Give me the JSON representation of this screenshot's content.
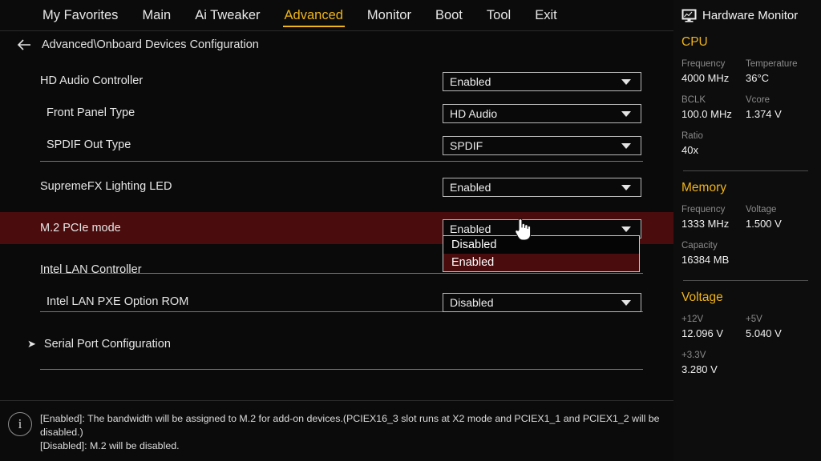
{
  "nav": {
    "items": [
      {
        "label": "My Favorites",
        "active": false
      },
      {
        "label": "Main",
        "active": false
      },
      {
        "label": "Ai Tweaker",
        "active": false
      },
      {
        "label": "Advanced",
        "active": true
      },
      {
        "label": "Monitor",
        "active": false
      },
      {
        "label": "Boot",
        "active": false
      },
      {
        "label": "Tool",
        "active": false
      },
      {
        "label": "Exit",
        "active": false
      }
    ],
    "active_color": "#f0b51a"
  },
  "breadcrumb": {
    "back_icon": "back-arrow-icon",
    "text": "Advanced\\Onboard Devices Configuration"
  },
  "settings": {
    "rows": [
      {
        "label": "HD Audio Controller",
        "value": "Enabled",
        "indent": 1,
        "highlight": false
      },
      {
        "label": "Front Panel Type",
        "value": "HD Audio",
        "indent": 2,
        "highlight": false
      },
      {
        "label": "SPDIF Out Type",
        "value": "SPDIF",
        "indent": 2,
        "highlight": false
      },
      {
        "label": "SupremeFX Lighting LED",
        "value": "Enabled",
        "indent": 1,
        "highlight": false
      },
      {
        "label": "M.2 PCIe mode",
        "value": "Enabled",
        "indent": 1,
        "highlight": true
      },
      {
        "label": "Intel LAN Controller",
        "value": "",
        "indent": 1,
        "highlight": false
      },
      {
        "label": "Intel LAN PXE Option ROM",
        "value": "Disabled",
        "indent": 2,
        "highlight": false
      }
    ],
    "submenu": {
      "label": "Serial Port Configuration",
      "arrow_icon": "chevron-right-icon"
    },
    "highlight_color": "#4a0c0c"
  },
  "dropdown": {
    "open": true,
    "for_row": "M.2 PCIe mode",
    "options": [
      {
        "label": "Disabled",
        "selected": false
      },
      {
        "label": "Enabled",
        "selected": true
      }
    ]
  },
  "help": {
    "icon": "info-icon",
    "line1": "[Enabled]: The bandwidth will be assigned to M.2 for add-on devices.(PCIEX16_3 slot runs at X2 mode and PCIEX1_1 and PCIEX1_2 will be disabled.)",
    "line2": "[Disabled]: M.2 will be disabled."
  },
  "hardware_monitor": {
    "icon": "monitor-chart-icon",
    "title": "Hardware Monitor",
    "groups": [
      {
        "title": "CPU",
        "pairs": [
          {
            "key": "Frequency",
            "value": "4000 MHz"
          },
          {
            "key": "Temperature",
            "value": "36°C"
          },
          {
            "key": "BCLK",
            "value": "100.0 MHz"
          },
          {
            "key": "Vcore",
            "value": "1.374 V"
          },
          {
            "key": "Ratio",
            "value": "40x"
          }
        ]
      },
      {
        "title": "Memory",
        "pairs": [
          {
            "key": "Frequency",
            "value": "1333 MHz"
          },
          {
            "key": "Voltage",
            "value": "1.500 V"
          },
          {
            "key": "Capacity",
            "value": "16384 MB"
          }
        ]
      },
      {
        "title": "Voltage",
        "pairs": [
          {
            "key": "+12V",
            "value": "12.096 V"
          },
          {
            "key": "+5V",
            "value": "5.040 V"
          },
          {
            "key": "+3.3V",
            "value": "3.280 V"
          }
        ]
      }
    ],
    "accent_color": "#f0b51a"
  },
  "cursor": {
    "type": "pointing-hand"
  }
}
